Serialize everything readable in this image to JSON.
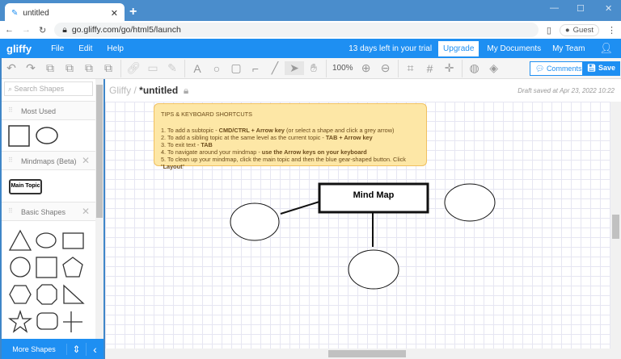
{
  "browser": {
    "tab_title": "untitled",
    "url": "go.gliffy.com/go/html5/launch",
    "profile": "Guest"
  },
  "header": {
    "logo": "gliffy",
    "menu": [
      "File",
      "Edit",
      "Help"
    ],
    "trial": "13 days left in your trial",
    "upgrade": "Upgrade",
    "my_documents": "My Documents",
    "my_team": "My Team"
  },
  "toolbar": {
    "zoom": "100%",
    "comments": "Comments",
    "save": "Save"
  },
  "sidebar": {
    "search_placeholder": "Search Shapes",
    "sections": [
      "Most Used",
      "Mindmaps (Beta)",
      "Basic Shapes"
    ],
    "main_topic": "Main Topic",
    "more_shapes": "More Shapes"
  },
  "doc": {
    "root": "Gliffy",
    "sep": "/",
    "title": "*untitled",
    "draft": "Draft saved at Apr 23, 2022 10:22"
  },
  "tips": {
    "title": "TIPS & KEYBOARD SHORTCUTS",
    "l1a": "1. To add a subtopic - ",
    "l1b": "CMD/CTRL + Arrow key",
    "l1c": " (or select a shape and click a grey arrow)",
    "l2a": "2. To add a sibling topic at the same level as the current topic - ",
    "l2b": "TAB + Arrow key",
    "l3a": "3. To exit text  - ",
    "l3b": "TAB",
    "l4a": "4. To navigate around your mindmap - ",
    "l4b": "use the Arrow keys on your keyboard",
    "l5a": "5. To clean up your mindmap, click the main topic and then the blue gear-shaped button.  Click \"",
    "l5b": "Layout",
    "l5c": "\""
  },
  "canvas": {
    "main_node": "Mind Map"
  }
}
